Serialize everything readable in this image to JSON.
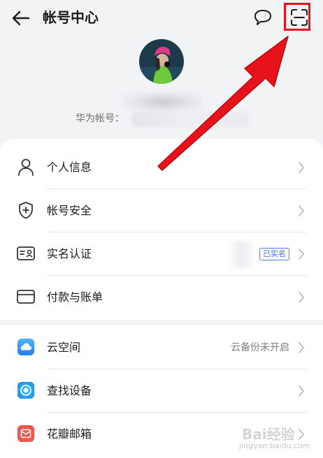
{
  "header": {
    "title": "帐号中心",
    "account_label": "华为帐号："
  },
  "menu_group_1": [
    {
      "label": "个人信息",
      "icon": "person-icon"
    },
    {
      "label": "帐号安全",
      "icon": "shield-icon"
    },
    {
      "label": "实名认证",
      "icon": "id-card-icon",
      "badge": "已实名"
    },
    {
      "label": "付款与账单",
      "icon": "card-icon"
    }
  ],
  "menu_group_2": [
    {
      "label": "云空间",
      "icon": "cloud-icon",
      "right_text": "云备份未开启"
    },
    {
      "label": "查找设备",
      "icon": "find-device-icon"
    },
    {
      "label": "花瓣邮箱",
      "icon": "mail-icon"
    }
  ],
  "watermark": {
    "line1": "Bai经验",
    "line2": "jingyan.baidu.com"
  },
  "colors": {
    "highlight": "#e8121b",
    "badge": "#3d6fd4",
    "background": "#f1f3f5"
  }
}
